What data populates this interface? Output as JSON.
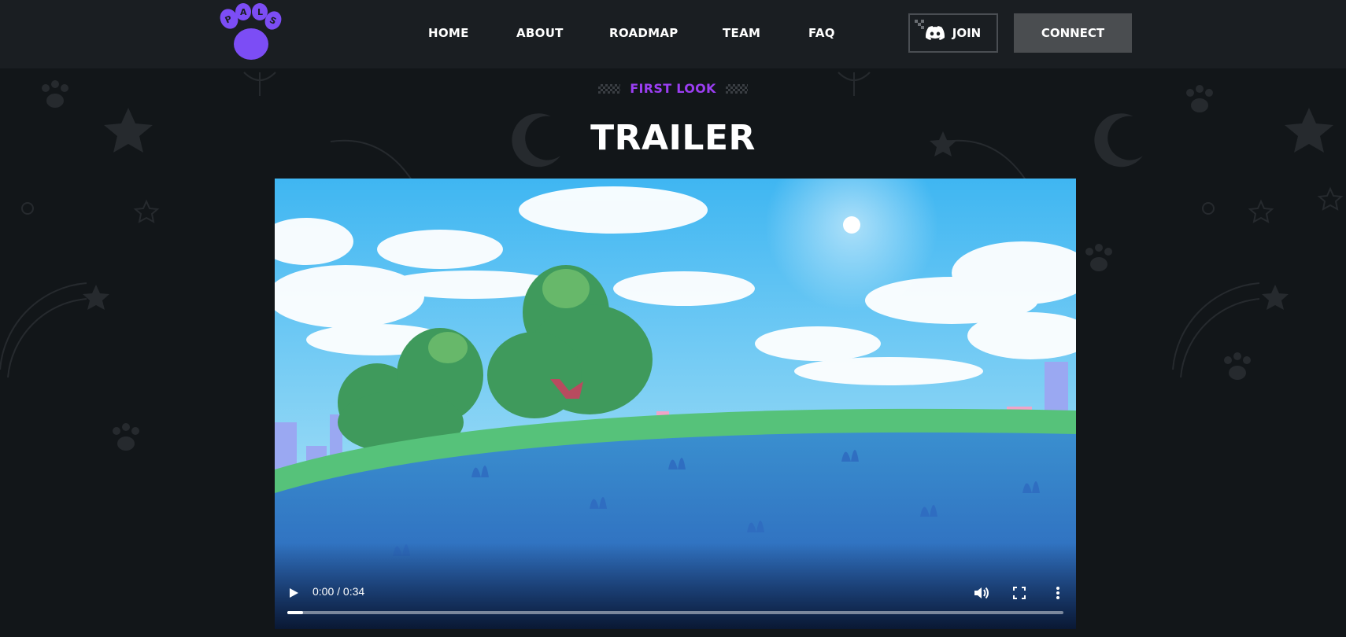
{
  "nav": {
    "links": [
      "HOME",
      "ABOUT",
      "ROADMAP",
      "TEAM",
      "FAQ"
    ],
    "join_label": "JOIN",
    "connect_label": "CONNECT",
    "logo_text": "PALS"
  },
  "section": {
    "eyebrow": "FIRST LOOK",
    "title": "TRAILER"
  },
  "video": {
    "time": "0:00 / 0:34",
    "progress": 0.02
  },
  "colors": {
    "accent": "#9b3ef2",
    "background": "#121619",
    "nav_bg": "#1a1e22"
  },
  "icons": [
    "paw-logo-icon",
    "discord-icon",
    "play-icon",
    "volume-icon",
    "fullscreen-icon",
    "more-options-icon"
  ]
}
